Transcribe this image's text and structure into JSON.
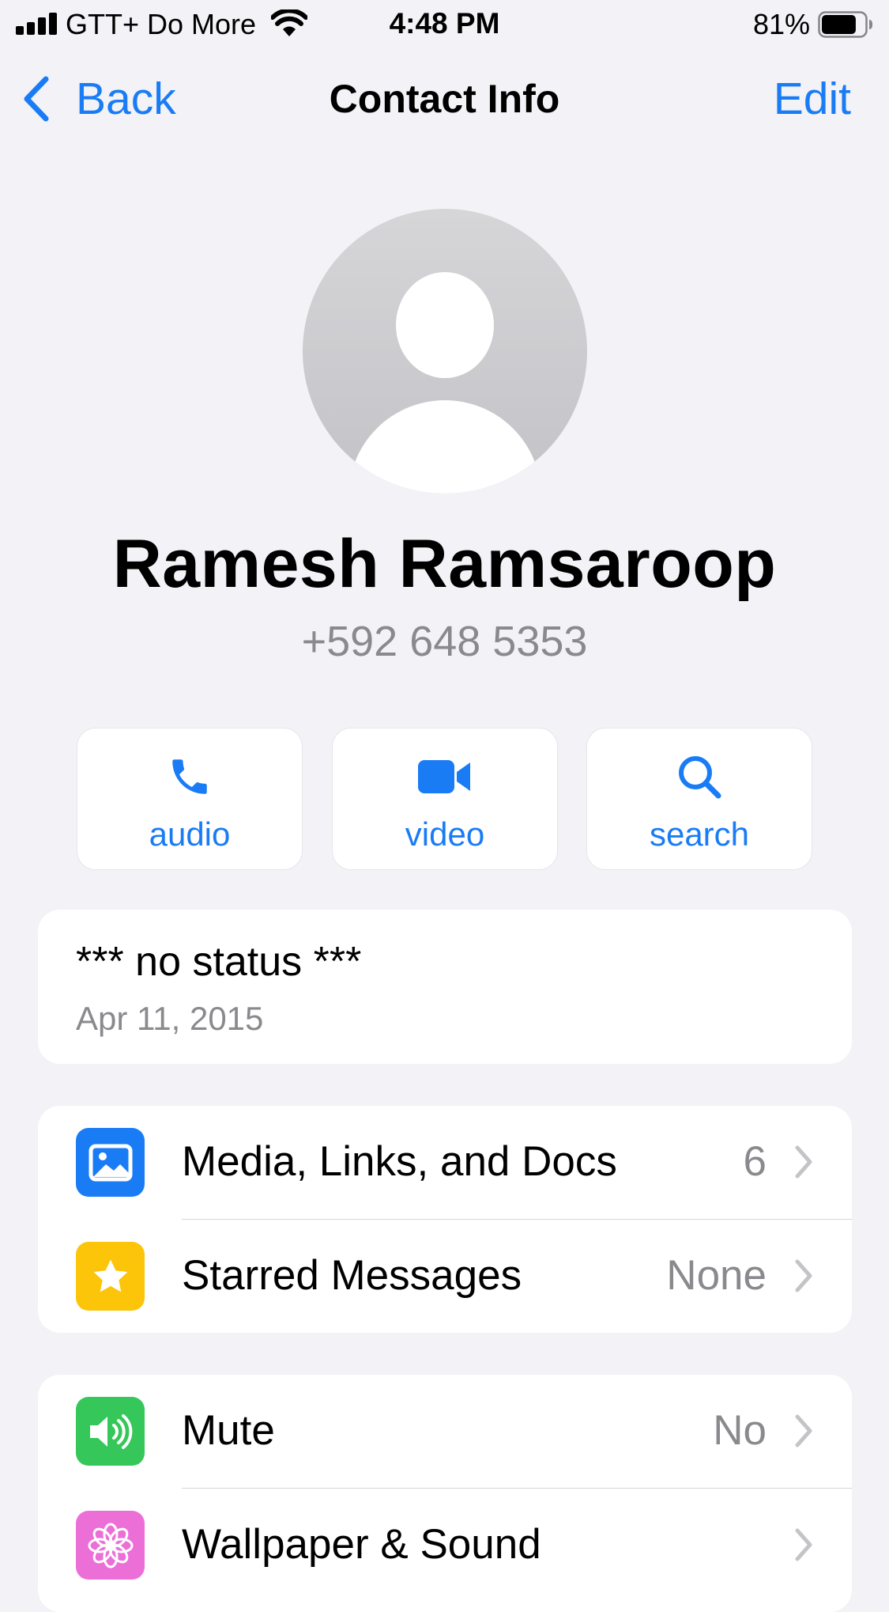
{
  "status_bar": {
    "carrier": "GTT+ Do More",
    "time": "4:48 PM",
    "battery_percent": "81%",
    "battery_level": 0.81
  },
  "nav": {
    "back_label": "Back",
    "title": "Contact Info",
    "edit_label": "Edit"
  },
  "contact": {
    "name": "Ramesh Ramsaroop",
    "phone": "+592 648 5353"
  },
  "actions": [
    {
      "label": "audio",
      "icon": "phone-icon"
    },
    {
      "label": "video",
      "icon": "video-camera-icon"
    },
    {
      "label": "search",
      "icon": "search-icon"
    }
  ],
  "status": {
    "text": "*** no status ***",
    "date": "Apr 11, 2015"
  },
  "list_group_1": [
    {
      "label": "Media, Links, and Docs",
      "value": "6",
      "icon": "photo-icon",
      "icon_bg": "#1a7cf5"
    },
    {
      "label": "Starred Messages",
      "value": "None",
      "icon": "star-icon",
      "icon_bg": "#fcc50a"
    }
  ],
  "list_group_2": [
    {
      "label": "Mute",
      "value": "No",
      "icon": "speaker-icon",
      "icon_bg": "#35c759"
    },
    {
      "label": "Wallpaper & Sound",
      "value": "",
      "icon": "flower-icon",
      "icon_bg": "#ec6fd8"
    }
  ],
  "colors": {
    "accent": "#1a7cf5",
    "background": "#f2f2f7",
    "secondary_text": "#8a8a8e"
  }
}
